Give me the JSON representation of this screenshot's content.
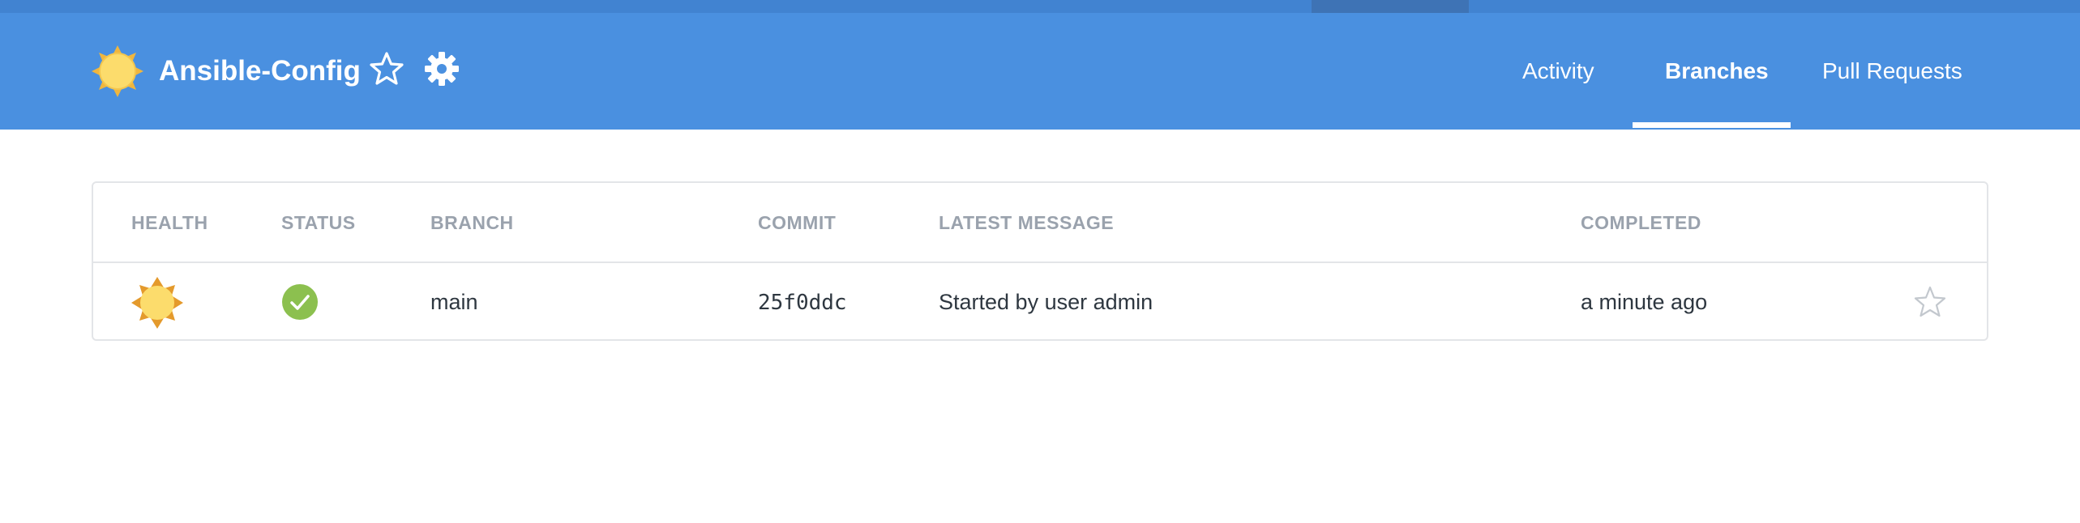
{
  "app": {
    "title": "Ansible-Config",
    "accent_color": "#4a90e0",
    "top_strip_color": "#4183d1"
  },
  "header": {
    "icons": [
      "weather-sunny-icon",
      "star-outline-icon",
      "gear-icon"
    ],
    "tabs": [
      {
        "label": "Activity",
        "active": false
      },
      {
        "label": "Branches",
        "active": true
      },
      {
        "label": "Pull Requests",
        "active": false
      }
    ]
  },
  "branches_table": {
    "columns": [
      "HEALTH",
      "STATUS",
      "BRANCH",
      "COMMIT",
      "LATEST MESSAGE",
      "COMPLETED"
    ],
    "rows": [
      {
        "health_icon": "weather-sunny-icon",
        "status_icon": "success-check-icon",
        "status_color": "#8cc04f",
        "branch": "main",
        "commit": "25f0ddc",
        "latest_message": "Started by user admin",
        "completed": "a minute ago",
        "favorite_icon": "star-outline-icon"
      }
    ]
  }
}
